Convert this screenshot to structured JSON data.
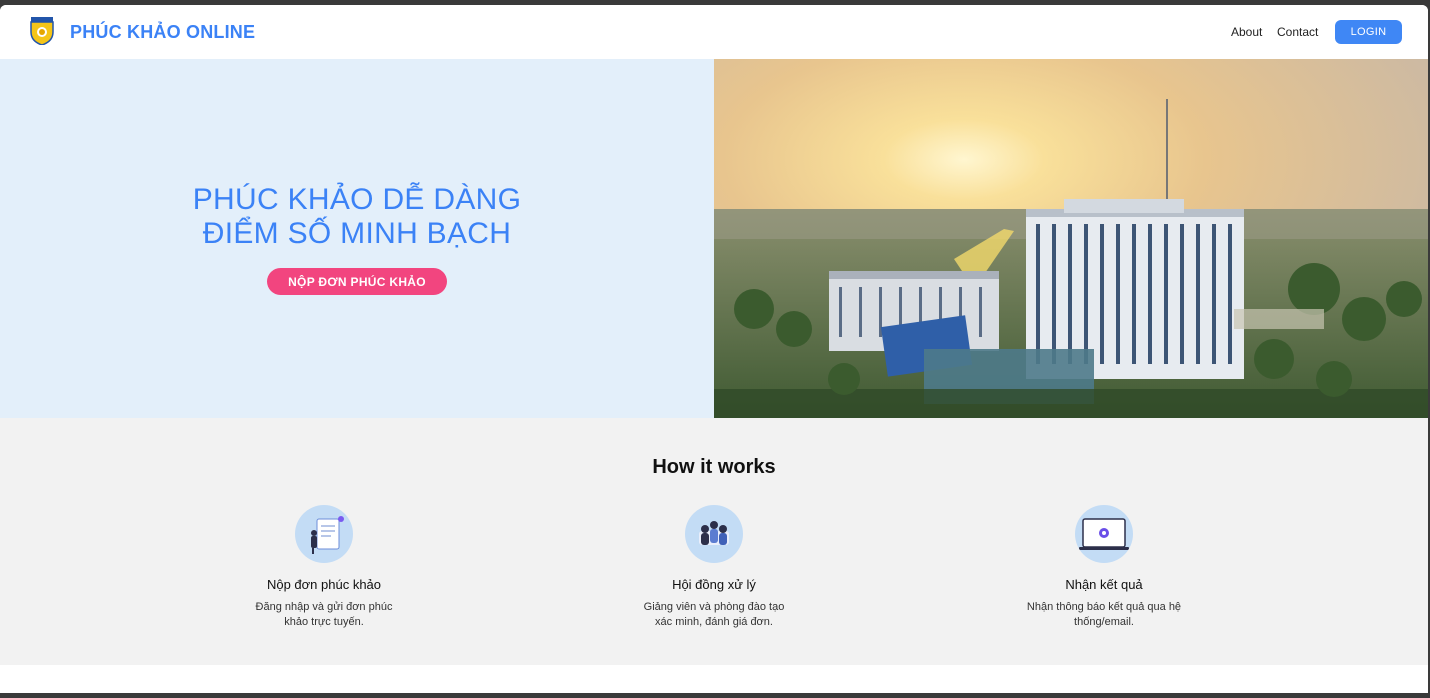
{
  "header": {
    "brand": "PHÚC KHẢO ONLINE",
    "nav": {
      "about": "About",
      "contact": "Contact",
      "login": "LOGIN"
    }
  },
  "hero": {
    "title_line1": "PHÚC KHẢO DỄ DÀNG",
    "title_line2": "ĐIỂM SỐ MINH BẠCH",
    "cta": "NỘP ĐƠN PHÚC KHẢO",
    "image": "campus-photo"
  },
  "how": {
    "title": "How it works",
    "steps": [
      {
        "icon": "document-person-icon",
        "title": "Nộp đơn phúc khảo",
        "desc": "Đăng nhập và gửi đơn phúc khảo trực tuyến."
      },
      {
        "icon": "meeting-group-icon",
        "title": "Hội đồng xử lý",
        "desc": "Giảng viên và phòng đào tạo xác minh, đánh giá đơn."
      },
      {
        "icon": "laptop-result-icon",
        "title": "Nhận kết quả",
        "desc": "Nhận thông báo kết quả qua hệ thống/email."
      }
    ]
  },
  "colors": {
    "brand": "#3b82f6",
    "cta": "#f2457f",
    "hero_bg": "#e3effa",
    "section_bg": "#f2f2f2"
  }
}
